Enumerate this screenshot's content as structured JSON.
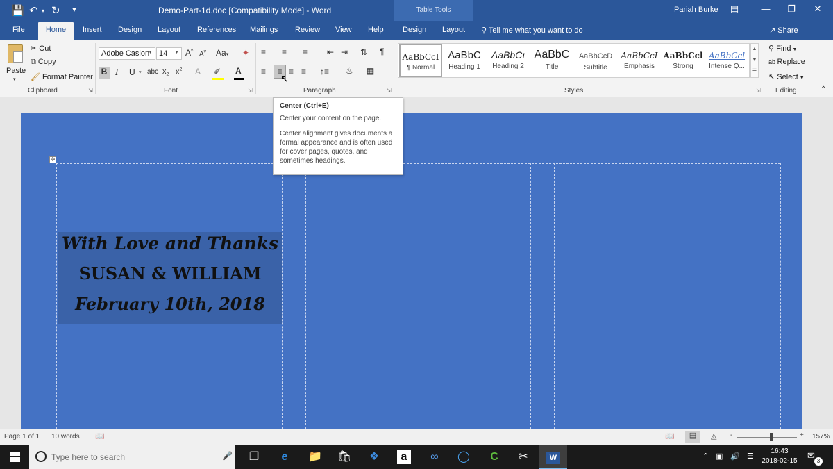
{
  "titlebar": {
    "doc_title": "Demo-Part-1d.doc [Compatibility Mode]  -  Word",
    "context_group": "Table Tools",
    "user": "Pariah Burke",
    "icons": [
      "save-icon",
      "undo-icon",
      "redo-icon",
      "customize-qat-icon",
      "ribbon-display-icon",
      "minimize-icon",
      "restore-icon",
      "close-icon"
    ]
  },
  "tabs": {
    "file": "File",
    "home": "Home",
    "insert": "Insert",
    "design": "Design",
    "layout": "Layout",
    "references": "References",
    "mailings": "Mailings",
    "review": "Review",
    "view": "View",
    "help": "Help",
    "table_design": "Design",
    "table_layout": "Layout",
    "tell_me": "Tell me what you want to do",
    "share": "Share"
  },
  "clipboard": {
    "label": "Clipboard",
    "paste": "Paste",
    "cut": "Cut",
    "copy": "Copy",
    "format_painter": "Format Painter"
  },
  "font": {
    "label": "Font",
    "family": "Adobe Caslon",
    "size": "14"
  },
  "paragraph": {
    "label": "Paragraph"
  },
  "styles": {
    "label": "Styles",
    "items": [
      {
        "sample": "AaBbCcI",
        "name": "¶ Normal"
      },
      {
        "sample": "AaBbC",
        "name": "Heading 1"
      },
      {
        "sample": "AaBbCı",
        "name": "Heading 2"
      },
      {
        "sample": "AaBbC",
        "name": "Title"
      },
      {
        "sample": "AaBbCcD",
        "name": "Subtitle"
      },
      {
        "sample": "AaBbCcI",
        "name": "Emphasis"
      },
      {
        "sample": "AaBbCcl",
        "name": "Strong"
      },
      {
        "sample": "AaBbCcl",
        "name": "Intense Q..."
      }
    ]
  },
  "editing": {
    "label": "Editing",
    "find": "Find",
    "replace": "Replace",
    "select": "Select"
  },
  "tooltip": {
    "title": "Center (Ctrl+E)",
    "line1": "Center your content on the page.",
    "line2": "Center alignment gives documents a formal appearance and is often used for cover pages, quotes, and sometimes headings."
  },
  "document": {
    "page_color": "#4472c4",
    "line1": "With Love and Thanks",
    "line2": "SUSAN & WILLIAM",
    "line3": "February 10th, 2018"
  },
  "status": {
    "page": "Page 1 of 1",
    "words": "10 words",
    "zoom": "157%",
    "zoom_minus": "-",
    "zoom_plus": "+"
  },
  "taskbar": {
    "search_placeholder": "Type here to search",
    "time": "16:43",
    "date": "2018-02-15",
    "notifications": "3"
  }
}
